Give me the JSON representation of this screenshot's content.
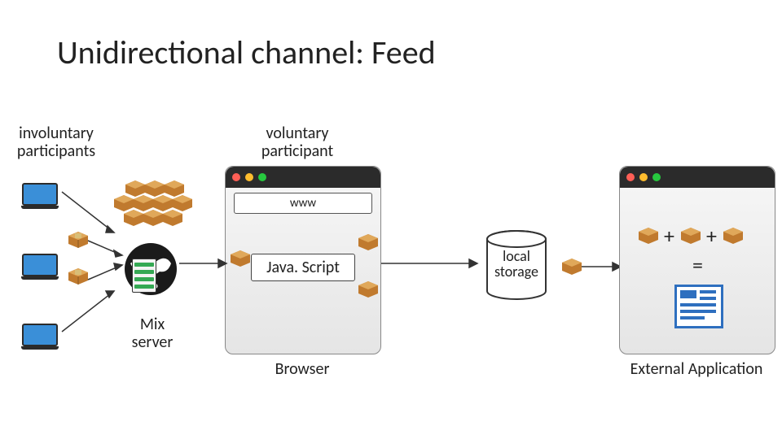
{
  "title": "Unidirectional channel: Feed",
  "labels": {
    "involuntary_participants": "involuntary\nparticipants",
    "voluntary_participant": "voluntary\nparticipant",
    "mix_server": "Mix\nserver",
    "browser": "Browser",
    "external_application": "External Application",
    "local_storage": "local\nstorage"
  },
  "browser_window": {
    "addr": "www",
    "js_button": "Java. Script"
  },
  "symbols": {
    "plus": "+",
    "equals": "="
  }
}
